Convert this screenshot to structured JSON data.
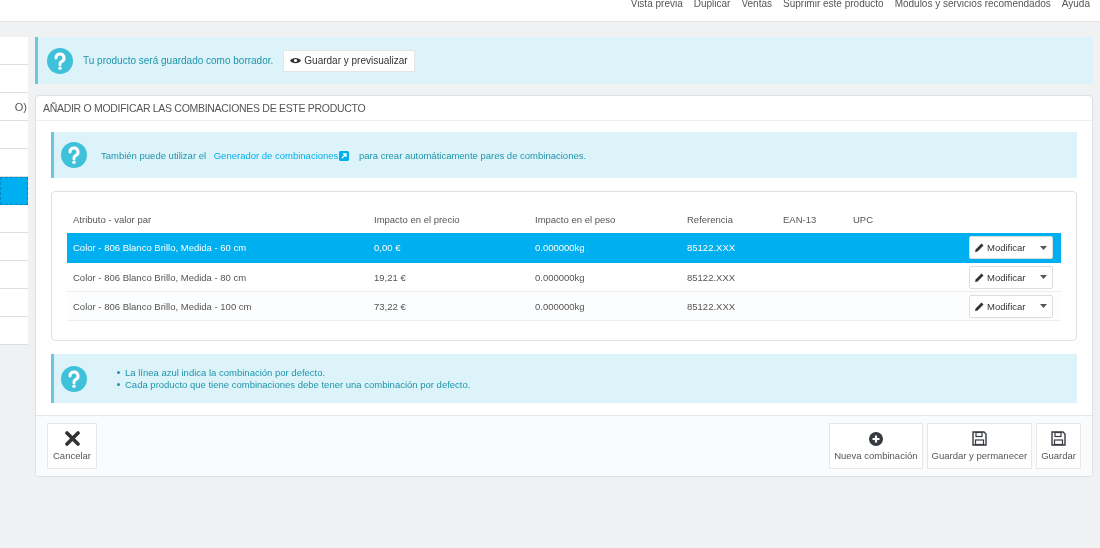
{
  "toolbar": {
    "links": [
      "Vista previa",
      "Duplicar",
      "Ventas",
      "Suprimir este producto",
      "Módulos y servicios recomendados",
      "Ayuda"
    ]
  },
  "sidebar": {
    "items": [
      {
        "selected": false
      },
      {
        "selected": false
      },
      {
        "label": "O)",
        "selected": false
      },
      {
        "selected": false
      },
      {
        "selected": false
      },
      {
        "selected": true
      },
      {
        "selected": false
      },
      {
        "selected": false
      },
      {
        "selected": false
      },
      {
        "selected": false
      },
      {
        "selected": false
      }
    ]
  },
  "draft_alert": {
    "text": "Tu producto será guardado como borrador.",
    "button": "Guardar y previsualizar"
  },
  "panel": {
    "title": "AÑADIR O MODIFICAR LAS COMBINACIONES DE ESTE PRODUCTO",
    "generator_alert": {
      "text_before": "También puede utilizar el",
      "link": "Generador de combinaciones",
      "text_after": "para crear automáticamente pares de combinaciones."
    },
    "table": {
      "columns": [
        "Atributo - valor par",
        "Impacto en el precio",
        "Impacto en el peso",
        "Referencia",
        "EAN-13",
        "UPC"
      ],
      "rows": [
        {
          "attribute": "Color - 806 Blanco Brillo, Medida - 60 cm",
          "price": "0,00 €",
          "weight": "0.000000kg",
          "reference": "85122.XXX",
          "action": "Modificar",
          "selected": true
        },
        {
          "attribute": "Color - 806 Blanco Brillo, Medida - 80 cm",
          "price": "19,21 €",
          "weight": "0.000000kg",
          "reference": "85122.XXX",
          "action": "Modificar",
          "selected": false
        },
        {
          "attribute": "Color - 806 Blanco Brillo, Medida - 100 cm",
          "price": "73,22 €",
          "weight": "0.000000kg",
          "reference": "85122.XXX",
          "action": "Modificar",
          "selected": false
        }
      ]
    },
    "notes": [
      "La línea azul indica la combinación por defecto.",
      "Cada producto que tiene combinaciones debe tener una combinación por defecto."
    ],
    "footer": {
      "cancel": "Cancelar",
      "buttons": [
        {
          "kind": "add",
          "label": "Nueva combinación"
        },
        {
          "kind": "save",
          "label": "Guardar y permanecer"
        },
        {
          "kind": "save",
          "label": "Guardar"
        }
      ]
    }
  }
}
